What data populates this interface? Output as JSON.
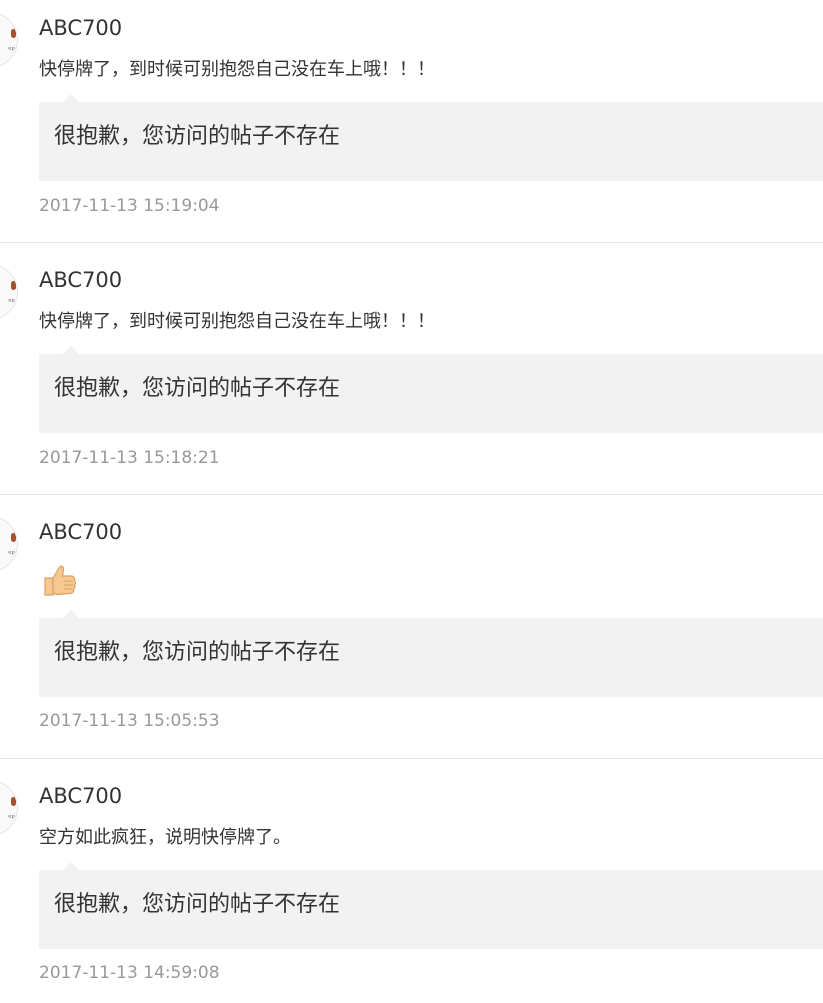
{
  "posts": [
    {
      "username": "ABC700",
      "content": "快停牌了，到时候可别抱怨自己没在车上哦！！！",
      "quoted": "很抱歉，您访问的帖子不存在",
      "time": "2017-11-13 15:19:04"
    },
    {
      "username": "ABC700",
      "content": "快停牌了，到时候可别抱怨自己没在车上哦！！！",
      "quoted": "很抱歉，您访问的帖子不存在",
      "time": "2017-11-13 15:18:21"
    },
    {
      "username": "ABC700",
      "emoji": "thumbs-up-emoji",
      "quoted": "很抱歉，您访问的帖子不存在",
      "time": "2017-11-13 15:05:53"
    },
    {
      "username": "ABC700",
      "content": "空方如此疯狂，说明快停牌了。",
      "quoted": "很抱歉，您访问的帖子不存在",
      "time": "2017-11-13 14:59:08"
    }
  ],
  "colors": {
    "text": "#333333",
    "timestamp": "#999999",
    "quote_background": "#f2f2f2",
    "divider": "#e6e6e6",
    "thumb": "#f5c98f"
  }
}
